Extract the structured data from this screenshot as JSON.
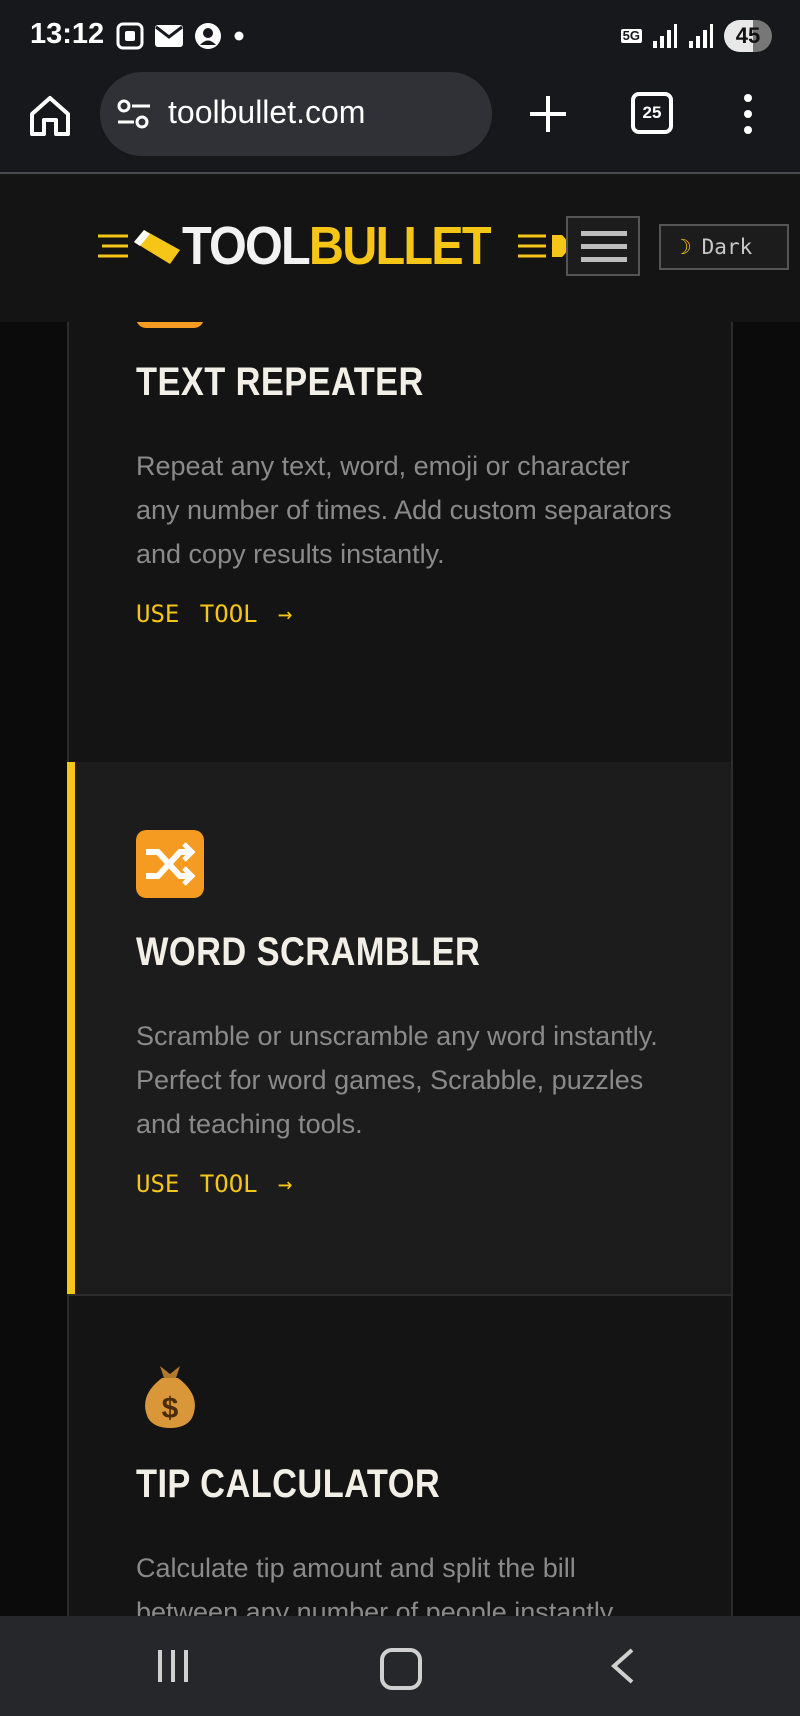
{
  "status_bar": {
    "time": "13:12",
    "network": "5G",
    "battery": "45"
  },
  "browser": {
    "url": "toolbullet.com",
    "tab_count": "25"
  },
  "header": {
    "logo_part1": "TOOL",
    "logo_part2": "BULLET",
    "theme_toggle_icon": "☽",
    "theme_toggle_label": "Dark"
  },
  "cards": [
    {
      "icon": "repeat-icon",
      "title": "TEXT REPEATER",
      "description": "Repeat any text, word, emoji or character any number of times. Add custom separators and copy results instantly.",
      "link": "USE TOOL →"
    },
    {
      "icon": "shuffle-icon",
      "title": "WORD SCRAMBLER",
      "description": "Scramble or unscramble any word instantly. Perfect for word games, Scrabble, puzzles and teaching tools.",
      "link": "USE TOOL →"
    },
    {
      "icon": "money-bag-icon",
      "title": "TIP CALCULATOR",
      "description": "Calculate tip amount and split the bill between any number of people instantly."
    }
  ],
  "colors": {
    "accent": "#f5c518",
    "background": "#0b0b0b",
    "card": "#141414",
    "card_active": "#1c1c1c"
  }
}
